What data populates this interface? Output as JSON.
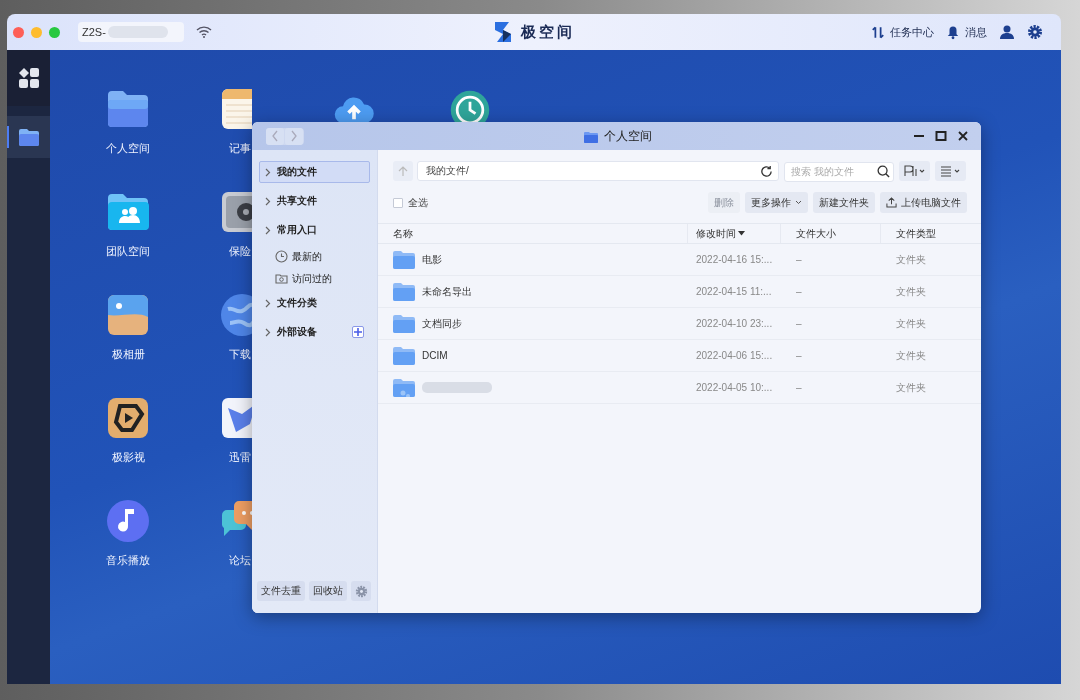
{
  "top_bar": {
    "device_name": "Z2S-",
    "app_title": "极空间",
    "actions": [
      {
        "kind": "tasks",
        "label": "任务中心"
      },
      {
        "kind": "messages",
        "label": "消息"
      },
      {
        "kind": "user"
      },
      {
        "kind": "settings"
      }
    ]
  },
  "dock": [
    {
      "kind": "apps",
      "selected": false
    },
    {
      "kind": "files",
      "selected": true
    }
  ],
  "desktop_columns": [
    [
      {
        "kind": "folder",
        "label": "个人空间"
      },
      {
        "kind": "team",
        "label": "团队空间"
      },
      {
        "kind": "photos",
        "label": "极相册"
      },
      {
        "kind": "video",
        "label": "极影视"
      },
      {
        "kind": "music",
        "label": "音乐播放"
      }
    ],
    [
      {
        "kind": "notes",
        "label": "记事"
      },
      {
        "kind": "safe",
        "label": "保险"
      },
      {
        "kind": "globe",
        "label": "下载"
      },
      {
        "kind": "bird",
        "label": "迅雷"
      },
      {
        "kind": "forum",
        "label": "论坛"
      }
    ]
  ],
  "partly_hidden_icons": [
    {
      "kind": "cloud-upload"
    },
    {
      "kind": "backup-clock"
    }
  ],
  "file_window": {
    "title": "个人空间",
    "sidebar": {
      "items": [
        {
          "label": "我的文件",
          "selected": true
        },
        {
          "label": "共享文件",
          "selected": false
        },
        {
          "label": "常用入口",
          "selected": false,
          "children": [
            {
              "kind": "recent",
              "label": "最新的",
              "selected": false
            },
            {
              "kind": "visited",
              "label": "访问过的",
              "selected": false
            }
          ]
        },
        {
          "label": "文件分类",
          "selected": false
        },
        {
          "label": "外部设备",
          "selected": false,
          "add_button": true
        }
      ],
      "footer_buttons": [
        "文件去重",
        "回收站"
      ]
    },
    "path": "我的文件/",
    "search": {
      "placeholder": "搜索 我的文件"
    },
    "select_all": {
      "label": "全选",
      "checked": false
    },
    "actions": [
      {
        "kind": "plain",
        "label": "删除",
        "disabled": true
      },
      {
        "kind": "plain",
        "label": "更多操作",
        "disabled": false,
        "dropdown": true
      },
      {
        "kind": "plain",
        "label": "新建文件夹",
        "disabled": false
      },
      {
        "kind": "upload",
        "label": "上传电脑文件",
        "disabled": false
      }
    ],
    "table": {
      "columns": [
        {
          "label": "名称",
          "sorted": false
        },
        {
          "label": "修改时间",
          "sorted": true
        },
        {
          "label": "文件大小",
          "sorted": false
        },
        {
          "label": "文件类型",
          "sorted": false
        }
      ],
      "rows": [
        {
          "kind": "folder",
          "name": "电影",
          "modified": "2022-04-16 15:...",
          "size": "–",
          "type": "文件夹"
        },
        {
          "kind": "folder",
          "name": "未命名导出",
          "modified": "2022-04-15 11:...",
          "size": "–",
          "type": "文件夹"
        },
        {
          "kind": "folder",
          "name": "文档同步",
          "modified": "2022-04-10 23:...",
          "size": "–",
          "type": "文件夹"
        },
        {
          "kind": "folder",
          "name": "DCIM",
          "modified": "2022-04-06 15:...",
          "size": "–",
          "type": "文件夹"
        },
        {
          "kind": "shared-folder",
          "modified": "2022-04-05 10:...",
          "size": "–",
          "type": "文件夹"
        }
      ]
    }
  }
}
